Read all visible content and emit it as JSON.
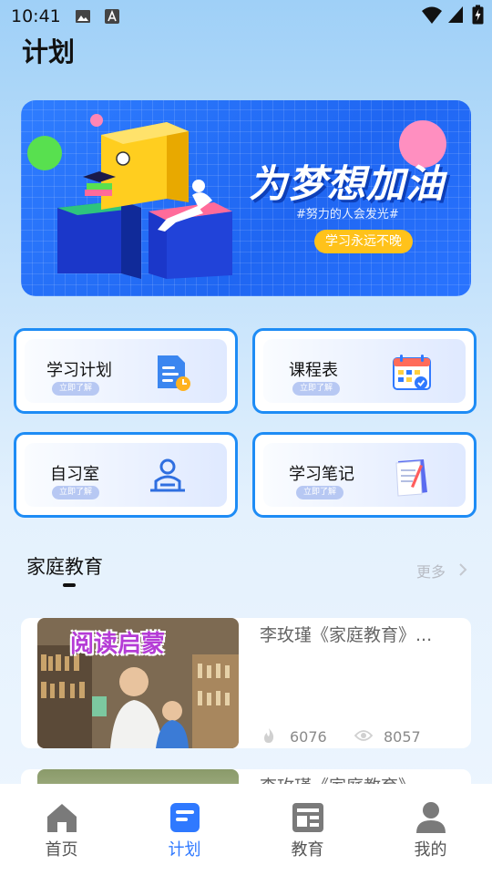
{
  "status_bar": {
    "time": "10:41"
  },
  "page": {
    "title": "计划"
  },
  "banner": {
    "headline": "为梦想加油",
    "subtitle": "#努力的人会发光#",
    "button_label": "学习永远不晚"
  },
  "cards": [
    {
      "label": "学习计划",
      "tag": "立即了解",
      "icon": "document-clock-icon"
    },
    {
      "label": "课程表",
      "tag": "立即了解",
      "icon": "calendar-check-icon"
    },
    {
      "label": "自习室",
      "tag": "立即了解",
      "icon": "person-reading-icon"
    },
    {
      "label": "学习笔记",
      "tag": "立即了解",
      "icon": "notebook-pen-icon"
    }
  ],
  "section": {
    "title": "家庭教育",
    "more_label": "更多"
  },
  "articles": [
    {
      "title": "李玫瑾《家庭教育》...",
      "thumb_text": "阅读启蒙",
      "likes": "6076",
      "views": "8057"
    },
    {
      "title": "李玫瑾《家庭教育》"
    }
  ],
  "tabbar": {
    "items": [
      {
        "label": "首页",
        "icon": "home-icon"
      },
      {
        "label": "计划",
        "icon": "plan-icon",
        "active": true
      },
      {
        "label": "教育",
        "icon": "news-icon"
      },
      {
        "label": "我的",
        "icon": "profile-icon"
      }
    ]
  },
  "colors": {
    "accent": "#2f79ff",
    "card_border": "#1e8cf5",
    "banner_button": "#ffc21a"
  }
}
